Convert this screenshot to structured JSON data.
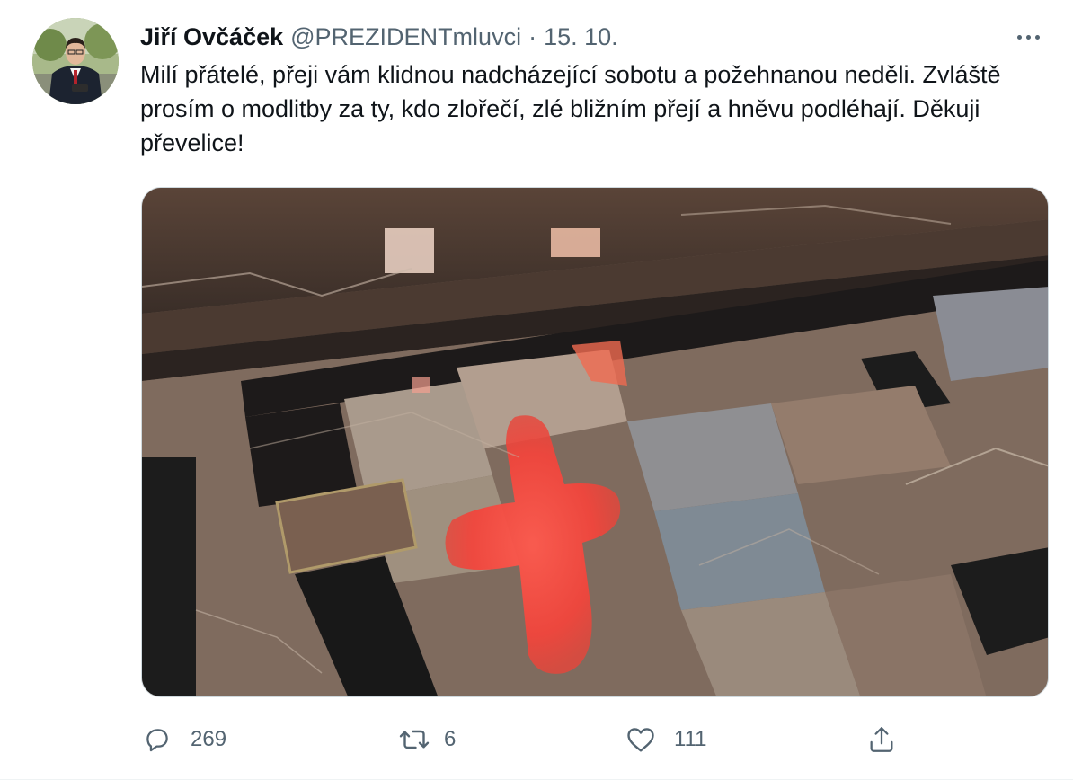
{
  "tweet": {
    "author_name": "Jiří Ovčáček",
    "handle": "@PREZIDENTmluvci",
    "separator": "·",
    "date": "15. 10.",
    "text": "Milí přátelé, přeji vám klidnou nadcházející sobotu a požehnanou neděli. Zvláště prosím o modlitby za ty, kdo zlořečí, zlé bližním přejí a hněvu podléhají. Děkuji převelice!",
    "media": {
      "description": "marble-floor-red-light-cross-photo"
    },
    "stats": {
      "replies": "269",
      "retweets": "6",
      "likes": "111"
    },
    "icons": {
      "reply": "reply-icon",
      "retweet": "retweet-icon",
      "like": "heart-icon",
      "share": "share-icon",
      "more": "more-icon"
    },
    "colors": {
      "text": "#0f1419",
      "secondary": "#536471",
      "border": "#cfd9de"
    }
  }
}
